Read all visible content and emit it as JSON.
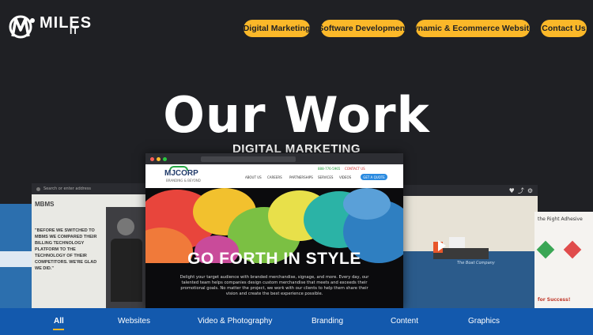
{
  "brand": {
    "logo_main": "MILES",
    "logo_sub": "IT"
  },
  "nav": {
    "items": [
      {
        "label": "Digital Marketing"
      },
      {
        "label": "Software Development"
      },
      {
        "label": "Dynamic & Ecommerce Websites"
      },
      {
        "label": "Contact Us"
      }
    ]
  },
  "hero": {
    "title": "Our Work",
    "subtitle": "DIGITAL MARKETING"
  },
  "showcase": {
    "main": {
      "logo": "MJCORP",
      "logo_tagline": "BRANDING & BEYOND",
      "nav": [
        "ABOUT US",
        "CAREERS",
        "PARTNERSHIPS",
        "SERVICES",
        "VIDEOS"
      ],
      "phone": "888-776-5965",
      "contact": "CONTACT US",
      "cta": "GET A QUOTE",
      "headline": "GO FORTH IN STYLE",
      "body": "Delight your target audience with branded merchandise, signage, and more. Every day, our talented team helps companies design custom merchandise that meets and exceeds their promotional goals. No matter the project, we work with our clients to help them share their vision and create the best experience possible."
    },
    "left": {
      "logo": "MBMS",
      "quote": "\"BEFORE WE SWITCHED TO MBMS WE COMPARED THEIR BILLING TECHNOLOGY PLATFORM TO THE TECHNOLOGY OF THEIR COMPETITORS. WE'RE GLAD WE DID.\"",
      "address_placeholder": "Search or enter address"
    },
    "right": {
      "caption": "The Boat Company",
      "side_heading": "the Right Adhesive",
      "side_footer": "for Success!"
    }
  },
  "filters": {
    "active": "All",
    "items": [
      "All",
      "Websites",
      "Video & Photography",
      "Branding",
      "Content",
      "Graphics"
    ]
  },
  "colors": {
    "background": "#1f2024",
    "accent": "#fbb829",
    "filter_bar": "#1359ad"
  }
}
